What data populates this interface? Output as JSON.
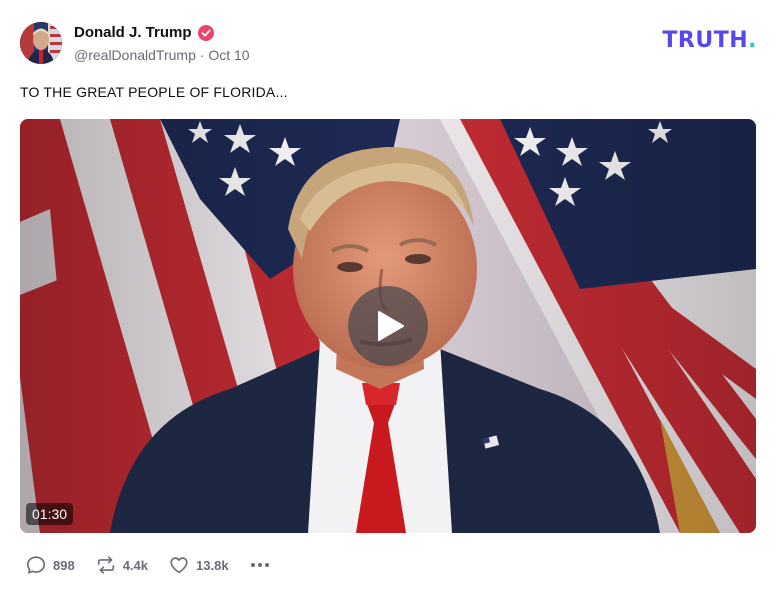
{
  "post": {
    "author_name": "Donald J. Trump",
    "handle": "@realDonaldTrump",
    "separator": "·",
    "date": "Oct 10",
    "text": "TO THE GREAT PEOPLE OF FLORIDA..."
  },
  "brand": {
    "name": "TRUTH",
    "dot": ".",
    "color": "#5448ee",
    "dot_color": "#19d4b4"
  },
  "video": {
    "duration": "01:30",
    "play_icon": "play-icon"
  },
  "actions": {
    "replies": "898",
    "retruths": "4.4k",
    "likes": "13.8k",
    "reply_icon": "comment-icon",
    "retruth_icon": "repost-icon",
    "like_icon": "heart-icon",
    "more_icon": "more-horizontal-icon"
  },
  "colors": {
    "verified": "#e8456b",
    "meta_text": "#6b6b78"
  }
}
